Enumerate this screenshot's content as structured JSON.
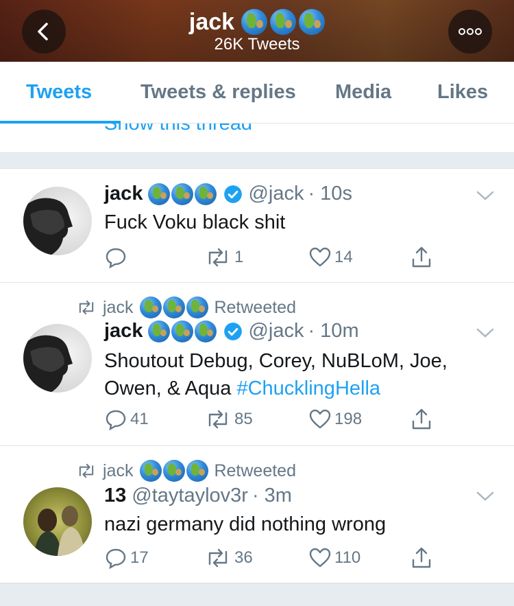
{
  "header": {
    "title": "jack",
    "title_emoji": [
      "globe-africa",
      "globe-asia",
      "globe-americas"
    ],
    "subtitle": "26K Tweets"
  },
  "tabs": [
    {
      "label": "Tweets",
      "active": true
    },
    {
      "label": "Tweets & replies",
      "active": false
    },
    {
      "label": "Media",
      "active": false
    },
    {
      "label": "Likes",
      "active": false
    }
  ],
  "thread_link": "Show this thread",
  "tweets": [
    {
      "retweeted_by": null,
      "name": "jack",
      "handle": "@jack",
      "time": "· 10s",
      "text": "Fuck Voku black shit",
      "hashtag": "",
      "verified": true,
      "reply_count": "",
      "retweet_count": "1",
      "like_count": "14"
    },
    {
      "retweeted_by": "jack",
      "retweeted_label": "Retweeted",
      "name": "jack",
      "handle": "@jack",
      "time": "· 10m",
      "text": "Shoutout Debug, Corey, NuBLoM, Joe, Owen, & Aqua ",
      "hashtag": "#ChucklingHella",
      "verified": true,
      "reply_count": "41",
      "retweet_count": "85",
      "like_count": "198"
    },
    {
      "retweeted_by": "jack",
      "retweeted_label": "Retweeted",
      "name": "13",
      "handle": "@taytaylov3r",
      "time": "· 3m",
      "text": "nazi germany did nothing wrong",
      "hashtag": "",
      "verified": false,
      "reply_count": "17",
      "retweet_count": "36",
      "like_count": "110"
    }
  ],
  "colors": {
    "accent": "#1da1f2",
    "secondary_text": "#657786",
    "divider": "#e6ecf0"
  }
}
